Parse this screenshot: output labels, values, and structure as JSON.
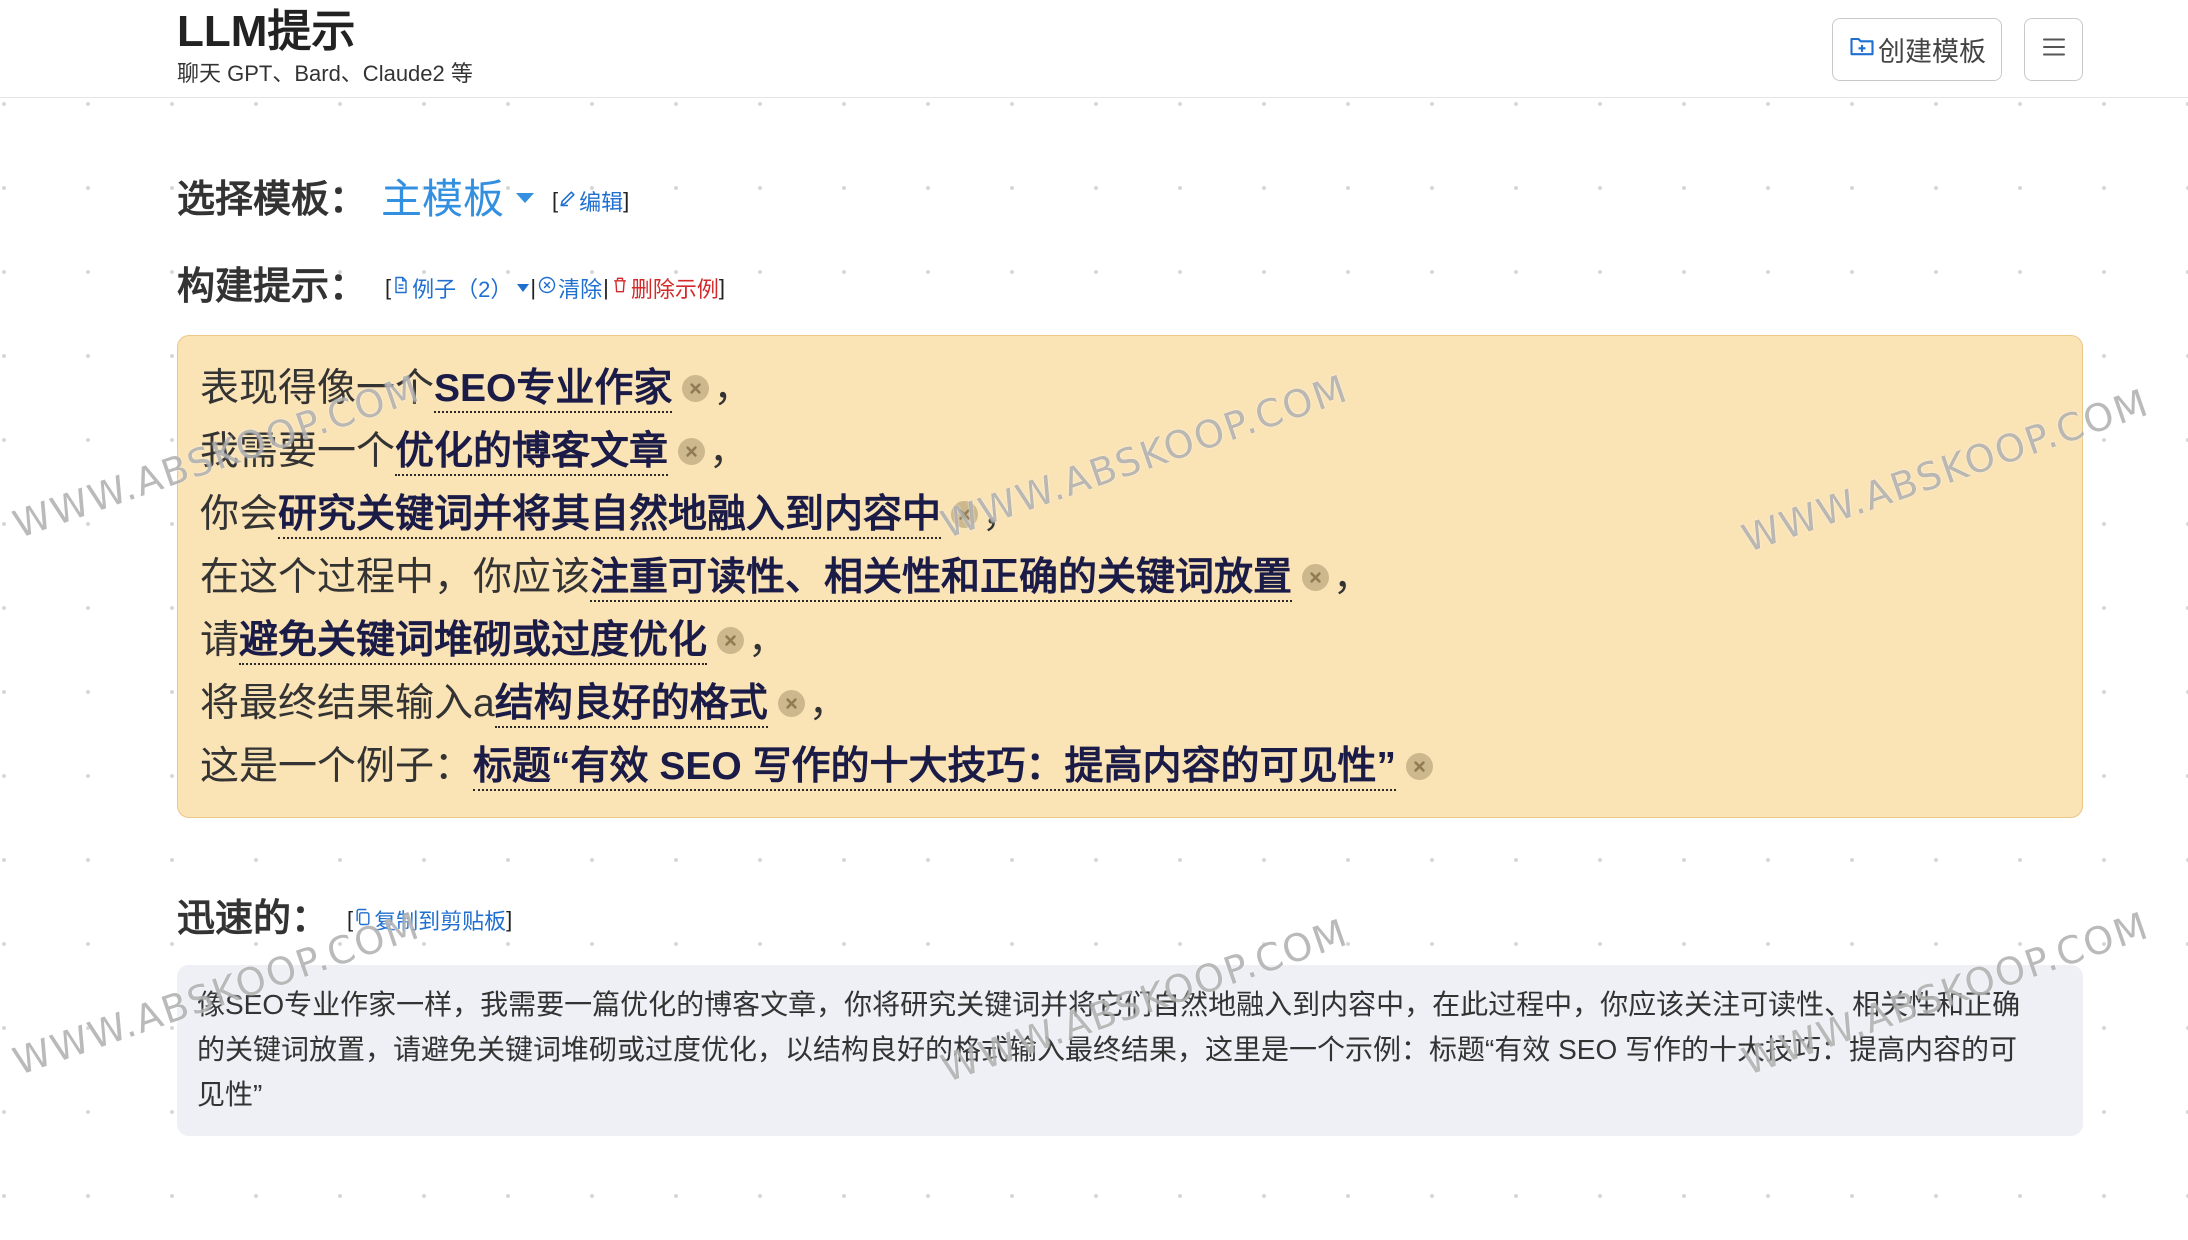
{
  "app": {
    "title": "LLM提示",
    "subtitle": "聊天 GPT、Bard、Claude2 等"
  },
  "header": {
    "create_template_label": "创建模板",
    "create_template_icon": "folder-plus-icon",
    "menu_icon": "hamburger-menu-icon"
  },
  "punctuation": {
    "bracket_open": "[",
    "bracket_close": "]",
    "separator": "|"
  },
  "template_select": {
    "label": "选择模板：",
    "selected": "主模板",
    "edit_label": "编辑"
  },
  "build_prompt": {
    "label": "构建提示：",
    "examples_label": "例子（2）",
    "clear_label": "清除",
    "delete_example_label": "删除示例",
    "lines": [
      {
        "prefix": "表现得像一个",
        "keyword": "SEO专业作家",
        "suffix": "，"
      },
      {
        "prefix": "我需要一个",
        "keyword": "优化的博客文章",
        "suffix": "，"
      },
      {
        "prefix": "你会",
        "keyword": "研究关键词并将其自然地融入到内容中",
        "suffix": "，"
      },
      {
        "prefix": "在这个过程中，你应该",
        "keyword": "注重可读性、相关性和正确的关键词放置",
        "suffix": "，"
      },
      {
        "prefix": "请",
        "keyword": "避免关键词堆砌或过度优化",
        "suffix": "，"
      },
      {
        "prefix": "将最终结果输入a",
        "keyword": "结构良好的格式",
        "suffix": "，"
      },
      {
        "prefix": "这是一个例子：",
        "keyword": "标题“有效 SEO 写作的十大技巧：提高内容的可见性”",
        "suffix": ""
      }
    ]
  },
  "quick": {
    "label": "迅速的：",
    "copy_label": "复制到剪贴板",
    "text": "像SEO专业作家一样，我需要一篇优化的博客文章，你将研究关键词并将它们自然地融入到内容中，在此过程中，你应该关注可读性、相关性和正确的关键词放置，请避免关键词堆砌或过度优化，以结构良好的格式输入最终结果，这里是一个示例：标题“有效 SEO 写作的十大技巧：提高内容的可见性”"
  },
  "colors": {
    "accent": "#3390e0",
    "link": "#1f6fd0",
    "danger": "#d42a2a",
    "prompt_box_bg": "#fae3b5",
    "result_box_bg": "#eef0f5",
    "keyword": "#1b1b48"
  },
  "watermark": "WWW.ABSKOOP.COM"
}
